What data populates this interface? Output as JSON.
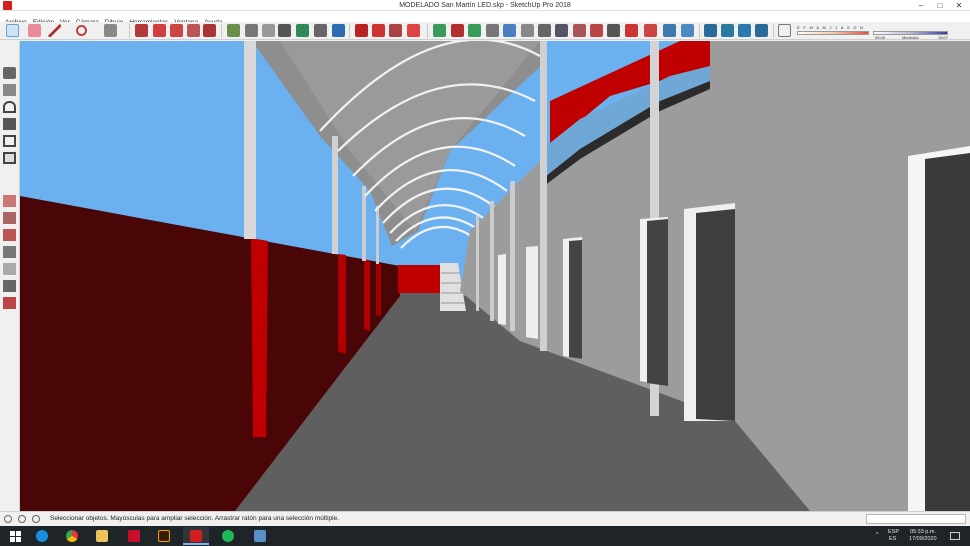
{
  "window": {
    "title": "MODELADO San Martín LED.skp - SketchUp Pro 2018",
    "controls": [
      "–",
      "□",
      "✕"
    ]
  },
  "menu": [
    "Archivo",
    "Edición",
    "Ver",
    "Cámara",
    "Dibujo",
    "Herramientas",
    "Ventana",
    "Ayuda"
  ],
  "shadows": {
    "months": "E F M A M J J A S O N D",
    "time_left": "05:45",
    "time_mid": "Mediodía",
    "time_right": "18:07"
  },
  "status": {
    "text": "Seleccionar objetos. Mayúsculas para ampliar selección. Arrastrar ratón para una selección múltiple.",
    "measurements_value": ""
  },
  "tray": {
    "language": "ESP",
    "language_sub": "ES",
    "time": "05:33 p.m.",
    "date": "17/09/2020"
  },
  "colors": {
    "wall_red": "#4a0606",
    "bright_red": "#c00000",
    "sky": "#6bb0ef",
    "floor": "#5f5f5f",
    "wall_grey": "#9c9c9c"
  }
}
